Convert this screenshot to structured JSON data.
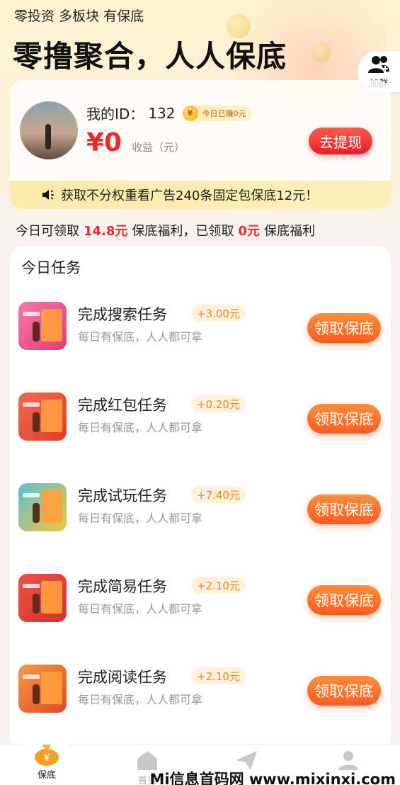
{
  "header": {
    "slogan_top": "零投资 多板块 有保底",
    "slogan_main": "零撸聚合，人人保底",
    "group_button_label": "加群"
  },
  "profile": {
    "id_label": "我的ID：",
    "id_value": "132",
    "today_earned_label": "今日已赚0元",
    "balance": "¥0",
    "balance_unit": "收益（元）",
    "withdraw_label": "去提现"
  },
  "notice": {
    "text": "获取不分权重看广告240条固定包保底12元！"
  },
  "summary": {
    "prefix": "今日可领取",
    "available_amount": "14.8元",
    "middle": "保底福利，已领取",
    "claimed_amount": "0元",
    "suffix": "保底福利"
  },
  "tasks": {
    "title": "今日任务",
    "items": [
      {
        "name": "完成搜索任务",
        "bonus": "+3.00元",
        "subtitle": "每日有保底，人人都可拿",
        "button": "领取保底",
        "thumb_color": "#f0508a"
      },
      {
        "name": "完成红包任务",
        "bonus": "+0.20元",
        "subtitle": "每日有保底，人人都可拿",
        "button": "领取保底",
        "thumb_color": "#ef4a3c"
      },
      {
        "name": "完成试玩任务",
        "bonus": "+7.40元",
        "subtitle": "每日有保底，人人都可拿",
        "button": "领取保底",
        "thumb_color": "#46b6c9"
      },
      {
        "name": "完成简易任务",
        "bonus": "+2.10元",
        "subtitle": "每日有保底，人人都可拿",
        "button": "领取保底",
        "thumb_color": "#e8423a"
      },
      {
        "name": "完成阅读任务",
        "bonus": "+2.10元",
        "subtitle": "每日有保底，人人都可拿",
        "button": "领取保底",
        "thumb_color": "#f07a3a"
      }
    ]
  },
  "tabbar": {
    "items": [
      {
        "label": "保底",
        "icon": "money-bag-icon",
        "active": true
      },
      {
        "label": "首页",
        "icon": "home-icon",
        "active": false
      },
      {
        "label": "",
        "icon": "paper-plane-icon",
        "active": false
      },
      {
        "label": "",
        "icon": "user-icon",
        "active": false
      }
    ]
  },
  "watermark": "Mi信息首码网 www.mixinxi.com",
  "colors": {
    "accent_red": "#f02828",
    "accent_orange": "#ff6a25",
    "active_tab": "#e8a21e"
  }
}
